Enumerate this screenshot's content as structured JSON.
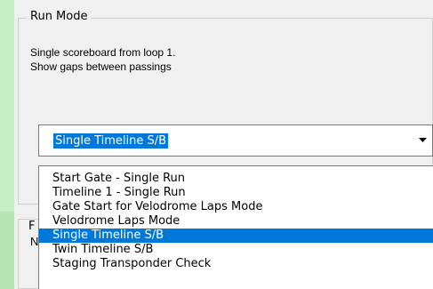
{
  "run_mode_group": {
    "title": "Run Mode",
    "description_line1": "Single scoreboard from loop 1.",
    "description_line2": "Show gaps between passings"
  },
  "second_group": {
    "title_partial": "F",
    "label_partial": "N"
  },
  "combo": {
    "value": "Single Timeline S/B",
    "arrow_icon": "chevron-down-icon"
  },
  "dropdown": {
    "options": [
      "Start Gate - Single Run",
      "Timeline 1 - Single Run",
      "Gate Start for Velodrome Laps Mode",
      "Velodrome Laps Mode",
      "Single Timeline S/B",
      "Twin Timeline S/B",
      "Staging Transponder Check"
    ],
    "selected_index": 4
  },
  "colors": {
    "selection": "#0078d7",
    "side_strip": "#c6efc6",
    "panel": "#f0f0f0"
  }
}
